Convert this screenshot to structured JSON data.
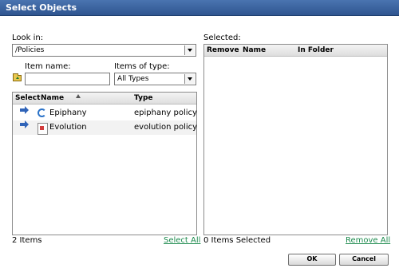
{
  "window": {
    "title": "Select Objects"
  },
  "look_in": {
    "label": "Look in:",
    "value": "/Policies"
  },
  "item_name": {
    "label": "Item name:",
    "value": ""
  },
  "items_of_type": {
    "label": "Items of type:",
    "value": "All Types"
  },
  "source_grid": {
    "columns": {
      "select": "Select",
      "name": "Name",
      "type": "Type"
    },
    "rows": [
      {
        "name": "Epiphany",
        "type": "epiphany policy",
        "icon": "epiphany-icon"
      },
      {
        "name": "Evolution",
        "type": "evolution policy",
        "icon": "evolution-icon"
      }
    ],
    "count_text": "2 Items",
    "select_all_label": "Select All"
  },
  "selected": {
    "label": "Selected:",
    "columns": {
      "remove": "Remove",
      "name": "Name",
      "folder": "In Folder"
    },
    "count_text": "0 Items Selected",
    "remove_all_label": "Remove All"
  },
  "buttons": {
    "ok": "OK",
    "cancel": "Cancel"
  },
  "colors": {
    "title_bar": "#3a63a3",
    "link": "#1d8b4e",
    "row_arrow": "#2f63b8"
  }
}
